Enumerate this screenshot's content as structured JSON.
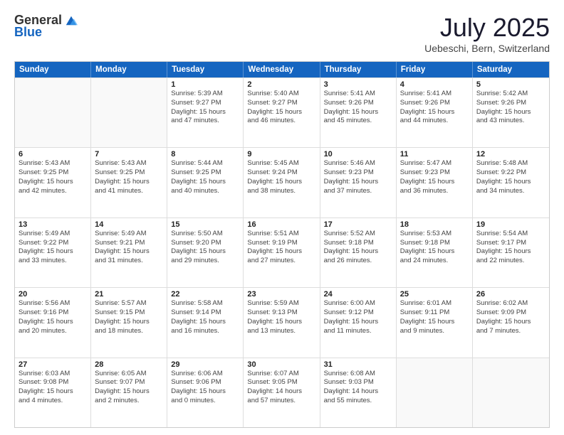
{
  "logo": {
    "general": "General",
    "blue": "Blue"
  },
  "title": {
    "month": "July 2025",
    "location": "Uebeschi, Bern, Switzerland"
  },
  "weekdays": [
    "Sunday",
    "Monday",
    "Tuesday",
    "Wednesday",
    "Thursday",
    "Friday",
    "Saturday"
  ],
  "weeks": [
    [
      {
        "day": "",
        "info": "",
        "empty": true
      },
      {
        "day": "",
        "info": "",
        "empty": true
      },
      {
        "day": "1",
        "info": "Sunrise: 5:39 AM\nSunset: 9:27 PM\nDaylight: 15 hours\nand 47 minutes.",
        "empty": false
      },
      {
        "day": "2",
        "info": "Sunrise: 5:40 AM\nSunset: 9:27 PM\nDaylight: 15 hours\nand 46 minutes.",
        "empty": false
      },
      {
        "day": "3",
        "info": "Sunrise: 5:41 AM\nSunset: 9:26 PM\nDaylight: 15 hours\nand 45 minutes.",
        "empty": false
      },
      {
        "day": "4",
        "info": "Sunrise: 5:41 AM\nSunset: 9:26 PM\nDaylight: 15 hours\nand 44 minutes.",
        "empty": false
      },
      {
        "day": "5",
        "info": "Sunrise: 5:42 AM\nSunset: 9:26 PM\nDaylight: 15 hours\nand 43 minutes.",
        "empty": false
      }
    ],
    [
      {
        "day": "6",
        "info": "Sunrise: 5:43 AM\nSunset: 9:25 PM\nDaylight: 15 hours\nand 42 minutes.",
        "empty": false
      },
      {
        "day": "7",
        "info": "Sunrise: 5:43 AM\nSunset: 9:25 PM\nDaylight: 15 hours\nand 41 minutes.",
        "empty": false
      },
      {
        "day": "8",
        "info": "Sunrise: 5:44 AM\nSunset: 9:25 PM\nDaylight: 15 hours\nand 40 minutes.",
        "empty": false
      },
      {
        "day": "9",
        "info": "Sunrise: 5:45 AM\nSunset: 9:24 PM\nDaylight: 15 hours\nand 38 minutes.",
        "empty": false
      },
      {
        "day": "10",
        "info": "Sunrise: 5:46 AM\nSunset: 9:23 PM\nDaylight: 15 hours\nand 37 minutes.",
        "empty": false
      },
      {
        "day": "11",
        "info": "Sunrise: 5:47 AM\nSunset: 9:23 PM\nDaylight: 15 hours\nand 36 minutes.",
        "empty": false
      },
      {
        "day": "12",
        "info": "Sunrise: 5:48 AM\nSunset: 9:22 PM\nDaylight: 15 hours\nand 34 minutes.",
        "empty": false
      }
    ],
    [
      {
        "day": "13",
        "info": "Sunrise: 5:49 AM\nSunset: 9:22 PM\nDaylight: 15 hours\nand 33 minutes.",
        "empty": false
      },
      {
        "day": "14",
        "info": "Sunrise: 5:49 AM\nSunset: 9:21 PM\nDaylight: 15 hours\nand 31 minutes.",
        "empty": false
      },
      {
        "day": "15",
        "info": "Sunrise: 5:50 AM\nSunset: 9:20 PM\nDaylight: 15 hours\nand 29 minutes.",
        "empty": false
      },
      {
        "day": "16",
        "info": "Sunrise: 5:51 AM\nSunset: 9:19 PM\nDaylight: 15 hours\nand 27 minutes.",
        "empty": false
      },
      {
        "day": "17",
        "info": "Sunrise: 5:52 AM\nSunset: 9:18 PM\nDaylight: 15 hours\nand 26 minutes.",
        "empty": false
      },
      {
        "day": "18",
        "info": "Sunrise: 5:53 AM\nSunset: 9:18 PM\nDaylight: 15 hours\nand 24 minutes.",
        "empty": false
      },
      {
        "day": "19",
        "info": "Sunrise: 5:54 AM\nSunset: 9:17 PM\nDaylight: 15 hours\nand 22 minutes.",
        "empty": false
      }
    ],
    [
      {
        "day": "20",
        "info": "Sunrise: 5:56 AM\nSunset: 9:16 PM\nDaylight: 15 hours\nand 20 minutes.",
        "empty": false
      },
      {
        "day": "21",
        "info": "Sunrise: 5:57 AM\nSunset: 9:15 PM\nDaylight: 15 hours\nand 18 minutes.",
        "empty": false
      },
      {
        "day": "22",
        "info": "Sunrise: 5:58 AM\nSunset: 9:14 PM\nDaylight: 15 hours\nand 16 minutes.",
        "empty": false
      },
      {
        "day": "23",
        "info": "Sunrise: 5:59 AM\nSunset: 9:13 PM\nDaylight: 15 hours\nand 13 minutes.",
        "empty": false
      },
      {
        "day": "24",
        "info": "Sunrise: 6:00 AM\nSunset: 9:12 PM\nDaylight: 15 hours\nand 11 minutes.",
        "empty": false
      },
      {
        "day": "25",
        "info": "Sunrise: 6:01 AM\nSunset: 9:11 PM\nDaylight: 15 hours\nand 9 minutes.",
        "empty": false
      },
      {
        "day": "26",
        "info": "Sunrise: 6:02 AM\nSunset: 9:09 PM\nDaylight: 15 hours\nand 7 minutes.",
        "empty": false
      }
    ],
    [
      {
        "day": "27",
        "info": "Sunrise: 6:03 AM\nSunset: 9:08 PM\nDaylight: 15 hours\nand 4 minutes.",
        "empty": false
      },
      {
        "day": "28",
        "info": "Sunrise: 6:05 AM\nSunset: 9:07 PM\nDaylight: 15 hours\nand 2 minutes.",
        "empty": false
      },
      {
        "day": "29",
        "info": "Sunrise: 6:06 AM\nSunset: 9:06 PM\nDaylight: 15 hours\nand 0 minutes.",
        "empty": false
      },
      {
        "day": "30",
        "info": "Sunrise: 6:07 AM\nSunset: 9:05 PM\nDaylight: 14 hours\nand 57 minutes.",
        "empty": false
      },
      {
        "day": "31",
        "info": "Sunrise: 6:08 AM\nSunset: 9:03 PM\nDaylight: 14 hours\nand 55 minutes.",
        "empty": false
      },
      {
        "day": "",
        "info": "",
        "empty": true
      },
      {
        "day": "",
        "info": "",
        "empty": true
      }
    ]
  ]
}
